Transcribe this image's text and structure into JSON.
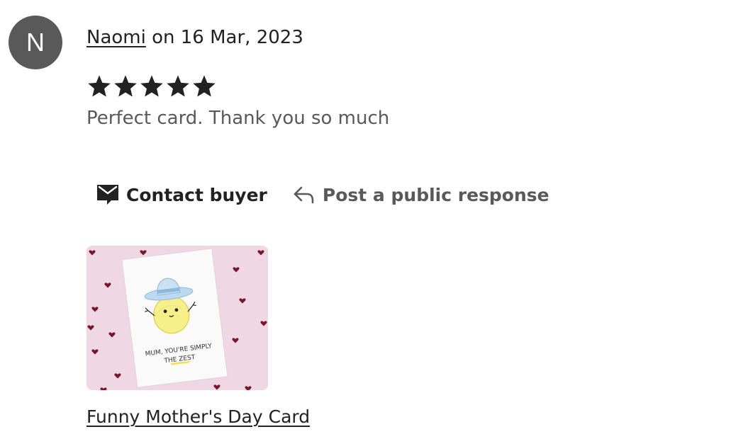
{
  "review": {
    "avatar_initial": "N",
    "reviewer_name": "Naomi",
    "date_text": " on 16 Mar, 2023",
    "rating": 5,
    "rating_max": 5,
    "text": "Perfect card. Thank you so much"
  },
  "actions": {
    "contact_label": "Contact buyer",
    "contact_icon": "envelope-icon",
    "respond_label": "Post a public response",
    "respond_icon": "reply-arrow-icon"
  },
  "product": {
    "card_text_line1": "MUM, YOU'RE SIMPLY",
    "card_text_line2": "THE ZEST",
    "link_text": "Funny Mother's Day Card"
  },
  "colors": {
    "avatar_bg": "#595959",
    "text_primary": "#222222",
    "text_secondary": "#595959",
    "star": "#222222",
    "thumb_bg": "#efd7e3",
    "heart": "#7a1428"
  }
}
